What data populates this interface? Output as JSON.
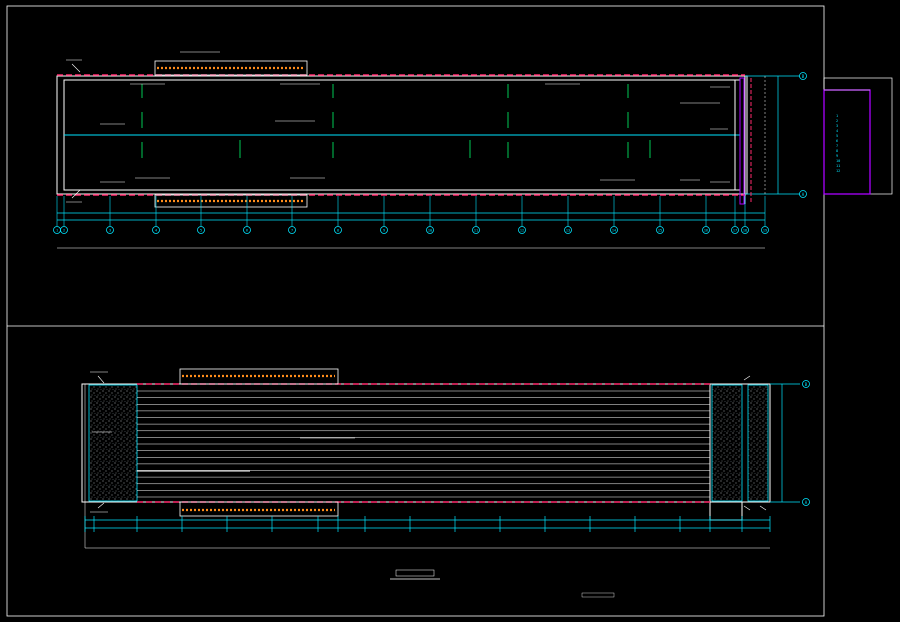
{
  "colors": {
    "background": "#000000",
    "frame": "#ffffff",
    "wall": "#ffffff",
    "dimension": "#00e5ff",
    "property_line": "#ff2a6d",
    "hatch": "#ff8c1a",
    "rebar": "#00c853",
    "detail_box": "#aa00ff",
    "legend_text": "#00e5ff"
  },
  "plan_top": {
    "grid_labels": [
      "1",
      "2",
      "3",
      "4",
      "5",
      "6",
      "7",
      "8",
      "9",
      "10",
      "11",
      "12",
      "13",
      "14",
      "15",
      "16",
      "17",
      "18",
      "19"
    ],
    "row_markers": [
      "B",
      "A"
    ],
    "bay_count": 16
  },
  "plan_bottom": {
    "row_markers": [
      "B",
      "A"
    ],
    "slab_line_count": 17
  },
  "legend": {
    "items": [
      "1",
      "2",
      "3",
      "4",
      "5",
      "6",
      "7",
      "8",
      "9",
      "10",
      "11",
      "12"
    ]
  }
}
